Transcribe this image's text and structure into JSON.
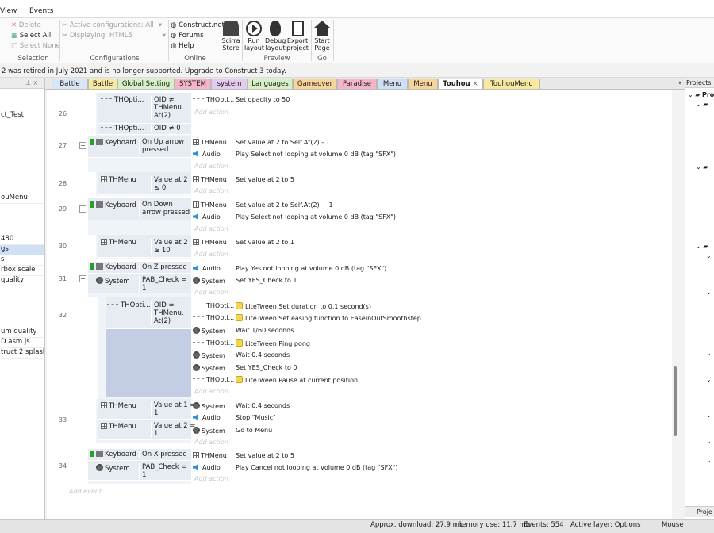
{
  "menubar": {
    "items": [
      "View",
      "Events"
    ]
  },
  "ribbon": {
    "edit": {
      "delete": "Delete",
      "select_all": "Select All",
      "select_none": "Select None",
      "group": "Selection"
    },
    "config": {
      "active": "Active configurations: All",
      "displaying": "Displaying: HTML5",
      "group": "Configurations"
    },
    "online": {
      "site": "Construct.net",
      "forums": "Forums",
      "help": "Help",
      "group": "Online"
    },
    "preview": {
      "scirra_store": "Scirra\nStore",
      "run_layout": "Run\nlayout",
      "debug_layout": "Debug\nlayout",
      "export_project": "Export\nproject",
      "group": "Preview"
    },
    "go": {
      "start_page": "Start\nPage",
      "group": "Go"
    }
  },
  "notice": "2 was retired in July 2021 and is no longer supported. Upgrade to Construct 3 today.",
  "left_panel": {
    "rows": [
      "ct_Test",
      "ouMenu",
      "480",
      "gs",
      "s",
      "rbox scale",
      "quality",
      "um quality",
      "D asm.js",
      "truct 2 splash"
    ]
  },
  "tabs": [
    "Battle",
    "Battle",
    "Global Setting",
    "SYSTEM",
    "system",
    "Languages",
    "Gameover",
    "Paradise",
    "Menu",
    "Menu",
    "Touhou",
    "TouhouMenu"
  ],
  "tab_close": "×",
  "right_panel": {
    "title": "Projects",
    "root": "Pro",
    "bottom": "Proje"
  },
  "events": {
    "add_action": "Add action",
    "add_event": "Add event",
    "rows": [
      {
        "num": "26",
        "conds": [
          {
            "obj": "THOpti...",
            "text": "OID ≠\nTHMenu.\nAt(2)"
          },
          {
            "obj": "THOpti...",
            "text": "OID ≠ 0"
          }
        ],
        "acts": [
          {
            "obj": "THOpti...",
            "text": "Set opacity to 50"
          }
        ]
      },
      {
        "num": "27",
        "conds": [
          {
            "obj": "Keyboard",
            "text": "On Up arrow\npressed"
          }
        ],
        "acts": [
          {
            "obj": "THMenu",
            "text": "Set value at 2 to Self.At(2) - 1"
          },
          {
            "obj": "Audio",
            "text": "Play Select not looping at volume 0 dB (tag \"SFX\")"
          }
        ]
      },
      {
        "num": "28",
        "conds": [
          {
            "obj": "THMenu",
            "text": "Value at 2\n≤ 0"
          }
        ],
        "acts": [
          {
            "obj": "THMenu",
            "text": "Set value at 2 to 5"
          }
        ]
      },
      {
        "num": "29",
        "conds": [
          {
            "obj": "Keyboard",
            "text": "On Down\narrow pressed"
          }
        ],
        "acts": [
          {
            "obj": "THMenu",
            "text": "Set value at 2 to Self.At(2) + 1"
          },
          {
            "obj": "Audio",
            "text": "Play Select not looping at volume 0 dB (tag \"SFX\")"
          }
        ]
      },
      {
        "num": "30",
        "conds": [
          {
            "obj": "THMenu",
            "text": "Value at 2\n≥ 10"
          }
        ],
        "acts": [
          {
            "obj": "THMenu",
            "text": "Set value at 2 to 1"
          }
        ]
      },
      {
        "num": "31",
        "conds": [
          {
            "obj": "Keyboard",
            "text": "On Z pressed"
          },
          {
            "obj": "System",
            "text": "PAB_Check =\n1"
          }
        ],
        "acts": [
          {
            "obj": "Audio",
            "text": "Play Yes not looping at volume 0 dB (tag \"SFX\")"
          },
          {
            "obj": "System",
            "text": "Set YES_Check to 1"
          }
        ]
      },
      {
        "num": "32",
        "conds": [
          {
            "obj": "THOpti...",
            "text": "OID =\nTHMenu.\nAt(2)"
          }
        ],
        "acts": [
          {
            "obj": "THOpti...",
            "text": "LiteTween Set duration to 0.1 second(s)"
          },
          {
            "obj": "THOpti...",
            "text": "LiteTween Set easing function to EaseInOutSmoothstep"
          },
          {
            "obj": "System",
            "text": "Wait 1/60 seconds"
          },
          {
            "obj": "THOpti...",
            "text": "LiteTween Ping pong"
          },
          {
            "obj": "System",
            "text": "Wait 0.4 seconds"
          },
          {
            "obj": "System",
            "text": "Set YES_Check to 0"
          },
          {
            "obj": "THOpti...",
            "text": "LiteTween Pause at current position"
          }
        ]
      },
      {
        "num": "33",
        "conds": [
          {
            "obj": "THMenu",
            "text": "Value at 1 =\n1"
          },
          {
            "obj": "THMenu",
            "text": "Value at 2 =\n1"
          }
        ],
        "acts": [
          {
            "obj": "System",
            "text": "Wait 0.4 seconds"
          },
          {
            "obj": "Audio",
            "text": "Stop \"Music\""
          },
          {
            "obj": "System",
            "text": "Go to Menu"
          }
        ]
      },
      {
        "num": "34",
        "conds": [
          {
            "obj": "Keyboard",
            "text": "On X pressed"
          },
          {
            "obj": "System",
            "text": "PAB_Check =\n1"
          }
        ],
        "acts": [
          {
            "obj": "THMenu",
            "text": "Set value at 2 to 5"
          },
          {
            "obj": "Audio",
            "text": "Play Cancel not looping at volume 0 dB (tag \"SFX\")"
          }
        ]
      }
    ]
  },
  "status": {
    "download": "Approx. download: 27.9 mb",
    "memory": "memory use: 11.7 mb",
    "events": "Events: 554",
    "layer": "Active layer: Options",
    "mouse": "Mouse"
  },
  "colors": {
    "tabs": [
      "#d9e6f5",
      "#f7eaa0",
      "#d6f0c6",
      "#f4b5c8",
      "#e6cbf0",
      "#d6f0c6",
      "#f9d49a",
      "#f4b5c8",
      "#cfe0f5",
      "#f9d49a",
      "#ffffff",
      "#f7eaa0"
    ]
  }
}
